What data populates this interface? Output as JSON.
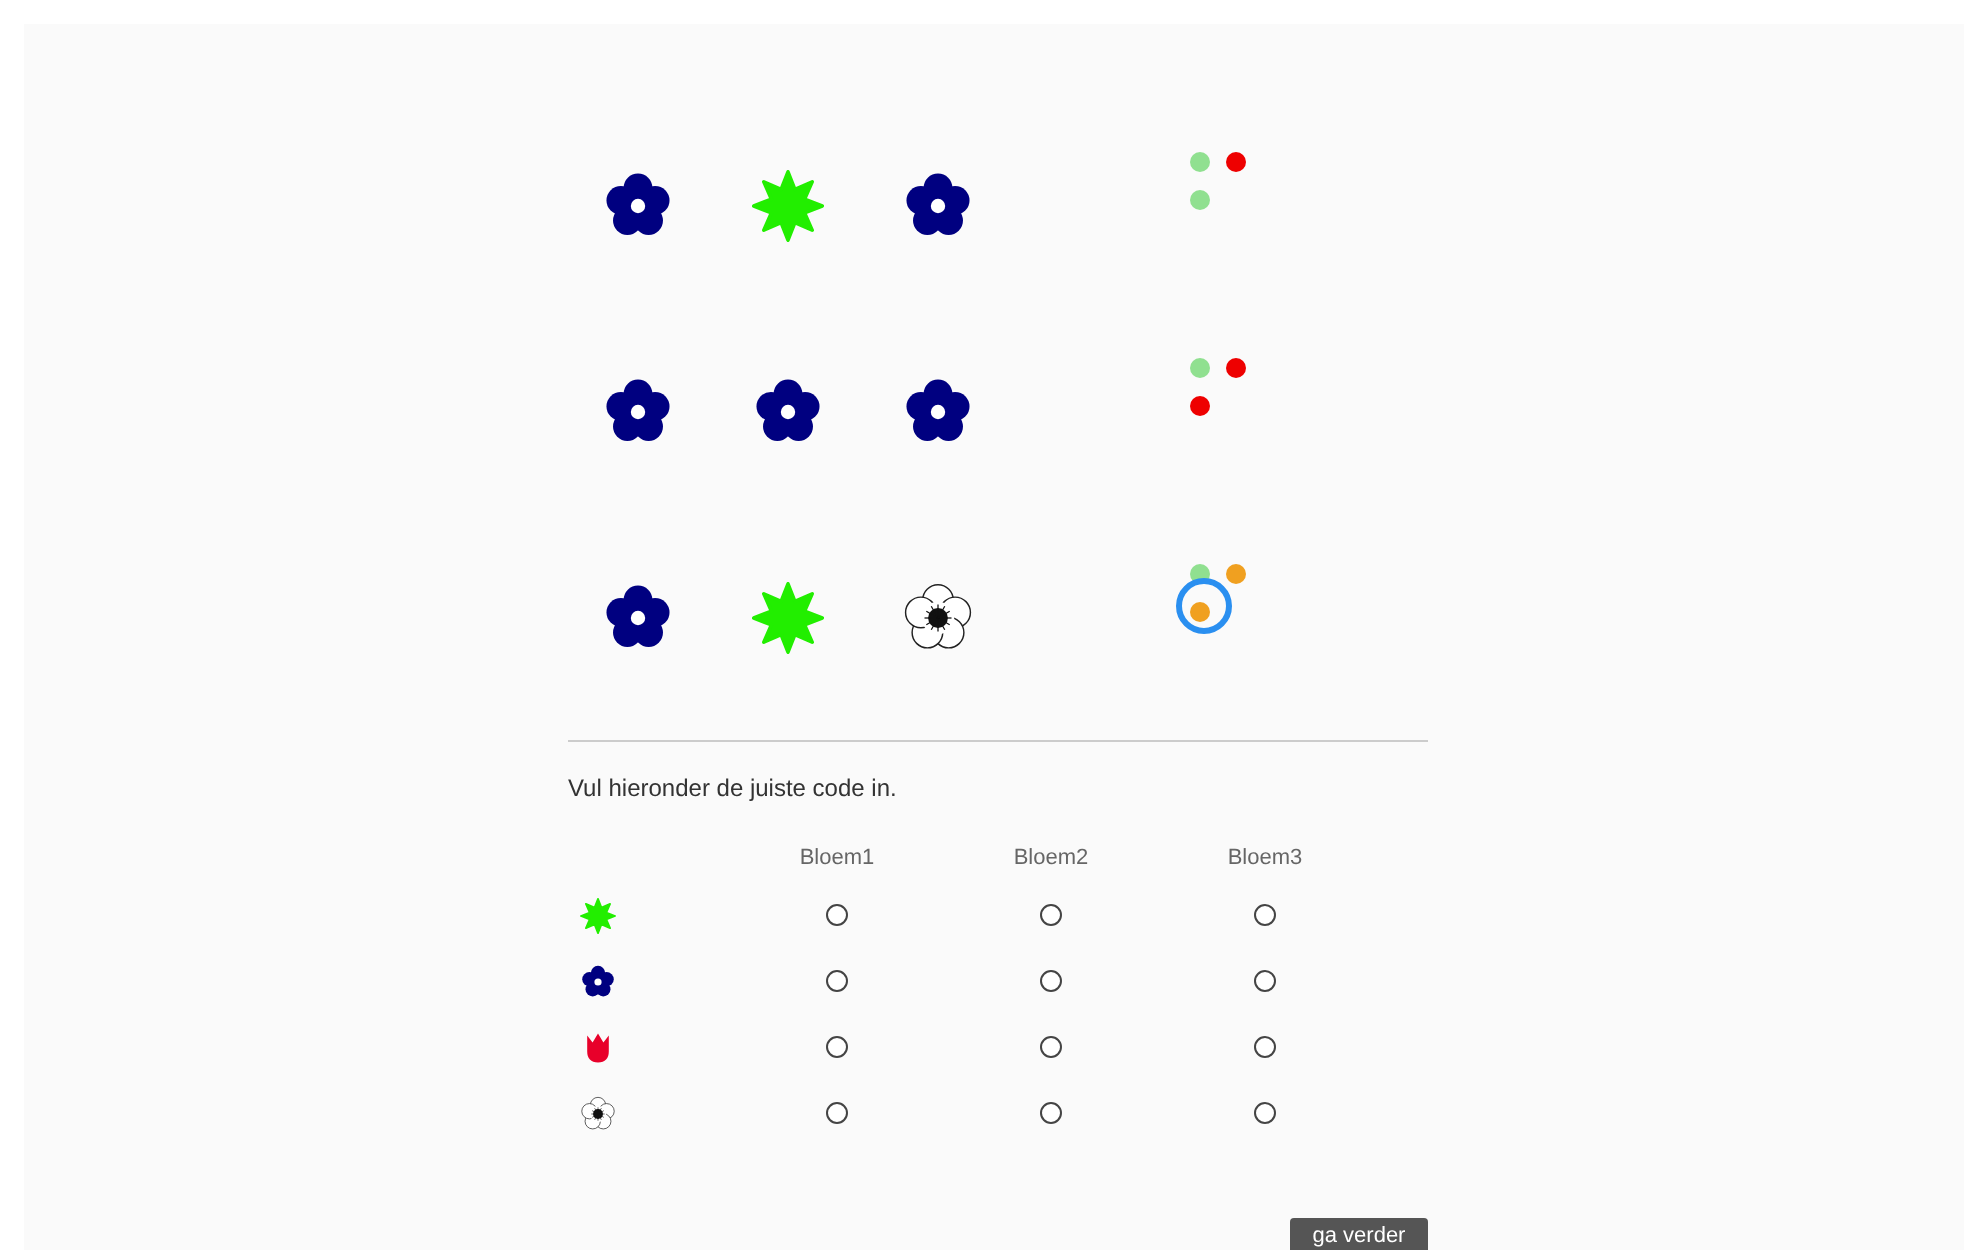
{
  "guesses": [
    {
      "flowers": [
        {
          "kind": "daisy"
        },
        {
          "kind": "star"
        },
        {
          "kind": "daisy"
        }
      ],
      "feedback": [
        {
          "color": "#90e090",
          "highlighted": false
        },
        {
          "color": "#ee0000",
          "highlighted": false
        },
        {
          "color": "#90e090",
          "highlighted": false
        }
      ]
    },
    {
      "flowers": [
        {
          "kind": "daisy"
        },
        {
          "kind": "daisy"
        },
        {
          "kind": "daisy"
        }
      ],
      "feedback": [
        {
          "color": "#90e090",
          "highlighted": false
        },
        {
          "color": "#ee0000",
          "highlighted": false
        },
        {
          "color": "#ee0000",
          "highlighted": false
        }
      ]
    },
    {
      "flowers": [
        {
          "kind": "daisy"
        },
        {
          "kind": "star"
        },
        {
          "kind": "anemone"
        }
      ],
      "feedback": [
        {
          "color": "#90e090",
          "highlighted": false
        },
        {
          "color": "#f0a020",
          "highlighted": false
        },
        {
          "color": "#f0a020",
          "highlighted": true
        }
      ]
    }
  ],
  "instruction": "Vul hieronder de juiste code in.",
  "answer": {
    "columns": [
      "Bloem1",
      "Bloem2",
      "Bloem3"
    ],
    "rows": [
      {
        "kind": "star",
        "options": [
          {
            "selected": false
          },
          {
            "selected": false
          },
          {
            "selected": false
          }
        ]
      },
      {
        "kind": "daisy",
        "options": [
          {
            "selected": false
          },
          {
            "selected": false
          },
          {
            "selected": false
          }
        ]
      },
      {
        "kind": "tulip",
        "options": [
          {
            "selected": false
          },
          {
            "selected": false
          },
          {
            "selected": false
          }
        ]
      },
      {
        "kind": "anemone",
        "options": [
          {
            "selected": false
          },
          {
            "selected": false
          },
          {
            "selected": false
          }
        ]
      }
    ]
  },
  "button": "ga verder"
}
